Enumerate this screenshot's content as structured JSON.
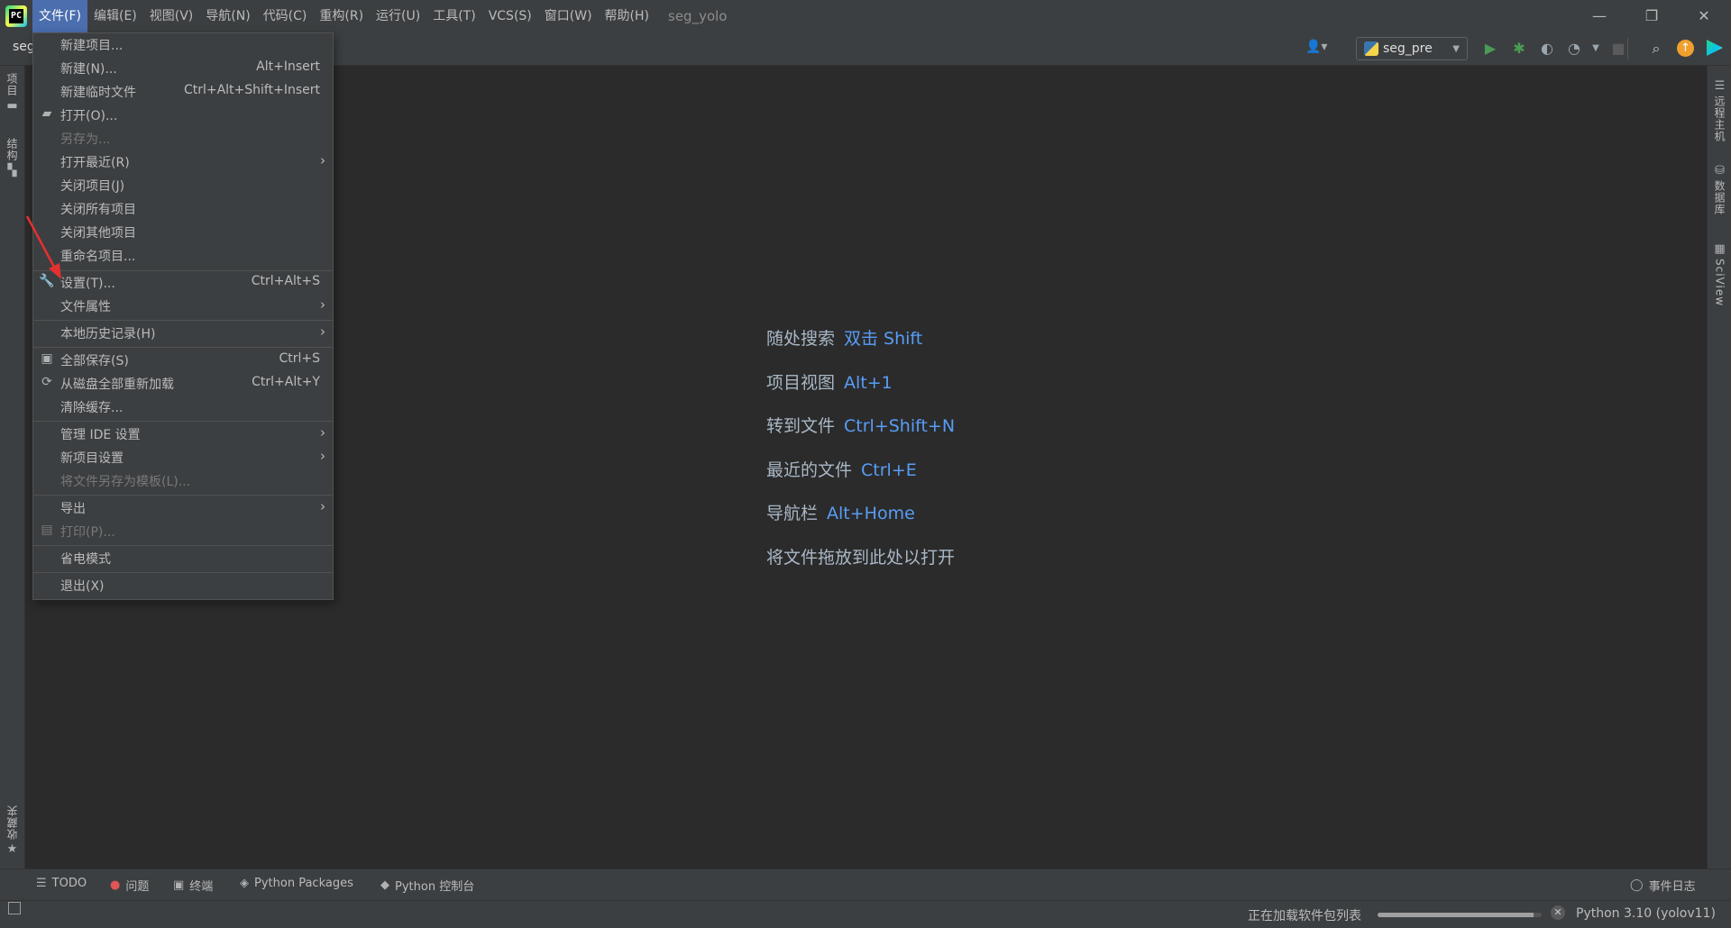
{
  "window": {
    "title": "seg_yolo",
    "controls": {
      "minimize": "—",
      "restore": "❐",
      "close": "✕"
    }
  },
  "menubar": [
    "文件(F)",
    "编辑(E)",
    "视图(V)",
    "导航(N)",
    "代码(C)",
    "重构(R)",
    "运行(U)",
    "工具(T)",
    "VCS(S)",
    "窗口(W)",
    "帮助(H)"
  ],
  "toolbar": {
    "project_crumb": "seg",
    "run_config": "seg_pre"
  },
  "file_menu": {
    "items": [
      {
        "label": "新建项目...",
        "shortcut": ""
      },
      {
        "label": "新建(N)...",
        "shortcut": "Alt+Insert"
      },
      {
        "label": "新建临时文件",
        "shortcut": "Ctrl+Alt+Shift+Insert"
      },
      {
        "label": "打开(O)...",
        "shortcut": "",
        "icon": "folder-open-icon"
      },
      {
        "label": "另存为...",
        "shortcut": "",
        "disabled": true
      },
      {
        "label": "打开最近(R)",
        "shortcut": "",
        "submenu": true
      },
      {
        "label": "关闭项目(J)",
        "shortcut": ""
      },
      {
        "label": "关闭所有项目",
        "shortcut": ""
      },
      {
        "label": "关闭其他项目",
        "shortcut": ""
      },
      {
        "label": "重命名项目...",
        "shortcut": ""
      },
      {
        "label": "设置(T)...",
        "shortcut": "Ctrl+Alt+S",
        "icon": "wrench-icon"
      },
      {
        "label": "文件属性",
        "shortcut": "",
        "submenu": true
      },
      {
        "label": "本地历史记录(H)",
        "shortcut": "",
        "submenu": true
      },
      {
        "label": "全部保存(S)",
        "shortcut": "Ctrl+S",
        "icon": "save-icon"
      },
      {
        "label": "从磁盘全部重新加载",
        "shortcut": "Ctrl+Alt+Y",
        "icon": "reload-icon"
      },
      {
        "label": "清除缓存...",
        "shortcut": ""
      },
      {
        "label": "管理 IDE 设置",
        "shortcut": "",
        "submenu": true
      },
      {
        "label": "新项目设置",
        "shortcut": "",
        "submenu": true
      },
      {
        "label": "将文件另存为模板(L)...",
        "shortcut": "",
        "disabled": true
      },
      {
        "label": "导出",
        "shortcut": "",
        "submenu": true
      },
      {
        "label": "打印(P)...",
        "shortcut": "",
        "disabled": true,
        "icon": "print-icon"
      },
      {
        "label": "省电模式",
        "shortcut": ""
      },
      {
        "label": "退出(X)",
        "shortcut": ""
      }
    ],
    "submenu_glyph": "›"
  },
  "left_strip": {
    "project": "项目",
    "structure": "结构",
    "favorites": "收藏夹"
  },
  "right_strip": {
    "remote_host": "远程主机",
    "database": "数据库",
    "sciview": "SciView"
  },
  "welcome_hints": [
    {
      "label": "随处搜索",
      "key": "双击 Shift"
    },
    {
      "label": "项目视图",
      "key": "Alt+1"
    },
    {
      "label": "转到文件",
      "key": "Ctrl+Shift+N"
    },
    {
      "label": "最近的文件",
      "key": "Ctrl+E"
    },
    {
      "label": "导航栏",
      "key": "Alt+Home"
    },
    {
      "label": "将文件拖放到此处以打开",
      "key": ""
    }
  ],
  "bottom_tools": {
    "todo": "TODO",
    "problems": "问题",
    "terminal": "终端",
    "python_packages": "Python Packages",
    "python_console": "Python 控制台",
    "event_log": "事件日志"
  },
  "status": {
    "loading_text": "正在加载软件包列表",
    "loading_progress": 0.95,
    "interpreter": "Python 3.10 (yolov11)"
  },
  "colors": {
    "menu_highlight": "#4b6eaf",
    "hint_key": "#589df6",
    "run_green": "#499c54",
    "annotation_red": "#e53030",
    "update_orange": "#f0a02e"
  }
}
